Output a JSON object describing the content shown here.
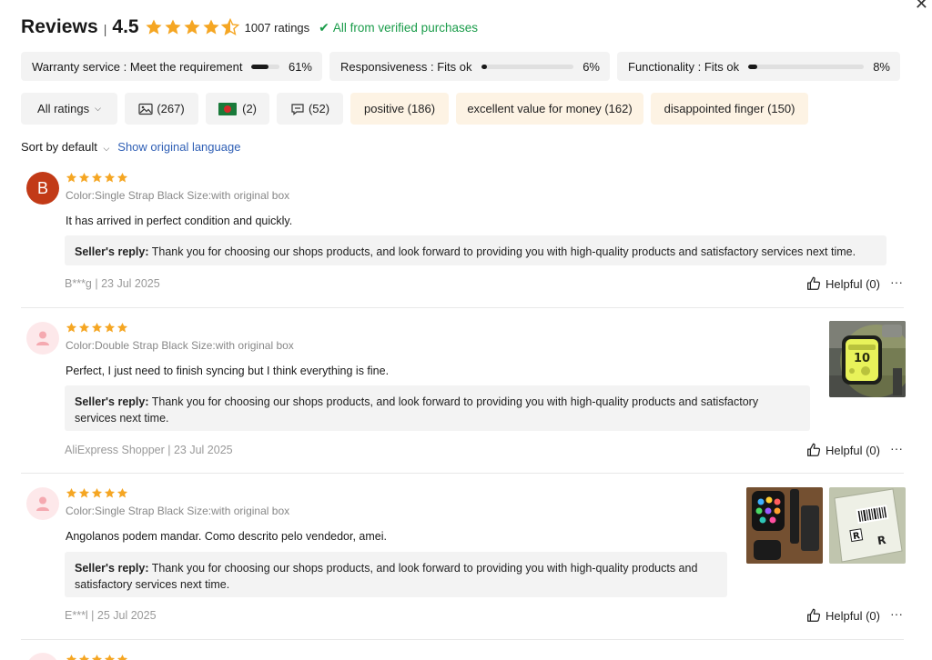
{
  "header": {
    "title": "Reviews",
    "separator": "|",
    "score": "4.5",
    "rating": 4.5,
    "count": "1007 ratings",
    "verified_icon": "check-icon",
    "verified": "All from verified purchases",
    "star_color": "#f5a623"
  },
  "metrics": [
    {
      "label": "Warranty service : Meet the requirement",
      "value": "61%",
      "fill": 0.61
    },
    {
      "label": "Responsiveness : Fits ok",
      "value": "6%",
      "fill": 0.06
    },
    {
      "label": "Functionality : Fits ok",
      "value": "8%",
      "fill": 0.08
    }
  ],
  "filters": {
    "all_ratings": "All ratings",
    "photos": "(267)",
    "country": "(2)",
    "comments": "(52)",
    "tags": [
      "positive (186)",
      "excellent value for money (162)",
      "disappointed finger (150)"
    ]
  },
  "sort": {
    "label": "Sort by default",
    "show_original": "Show original language"
  },
  "reviews": [
    {
      "avatar_letter": "B",
      "stars": 5,
      "variant": "Color:Single Strap Black Size:with original box",
      "text": "It has arrived in perfect condition and quickly.",
      "reply_label": "Seller's reply:",
      "reply": "Thank you for choosing our shops products, and look forward to providing you with high-quality products and satisfactory services next time.",
      "meta": "B***g | 23 Jul 2025",
      "helpful": "Helpful (0)",
      "more": "···"
    },
    {
      "stars": 5,
      "variant": "Color:Double Strap Black Size:with original box",
      "text": "Perfect, I just need to finish syncing but I think everything is fine.",
      "reply_label": "Seller's reply:",
      "reply_line1": "Thank you for choosing our shops products, and look forward to providing you with high-quality products and satisfactory",
      "reply_line2": "services next time.",
      "meta": "AliExpress Shopper | 23 Jul 2025",
      "helpful": "Helpful (0)",
      "more": "···",
      "photo_time": "10"
    },
    {
      "stars": 5,
      "variant": "Color:Single Strap Black Size:with original box",
      "text": "Angolanos podem mandar. Como descrito pelo vendedor, amei.",
      "reply_label": "Seller's reply:",
      "reply_line1": "Thank you for choosing our shops products, and look forward to providing you with high-quality products and",
      "reply_line2": "satisfactory services next time.",
      "meta": "E***l | 25 Jul 2025",
      "helpful": "Helpful (0)",
      "more": "···",
      "photo_letter": "R"
    }
  ]
}
